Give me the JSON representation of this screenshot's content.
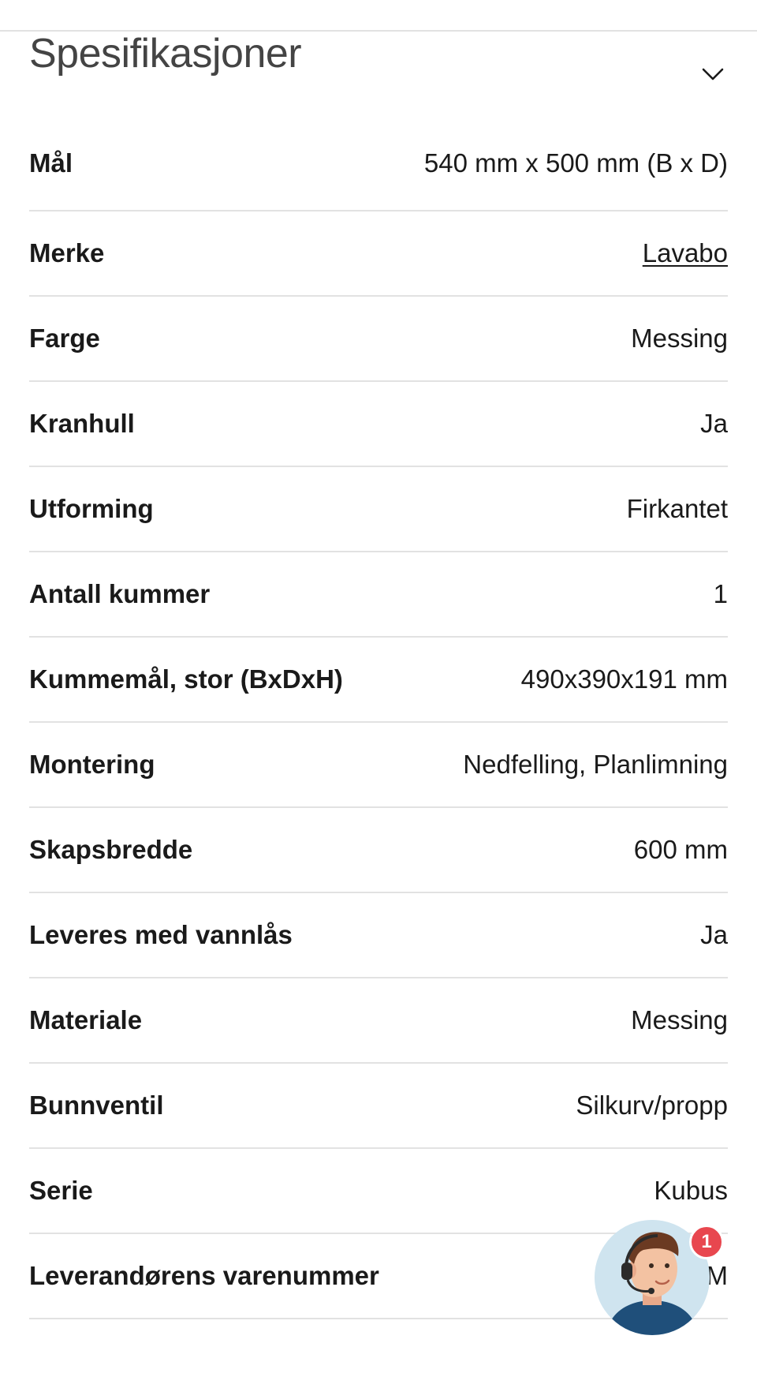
{
  "section": {
    "title": "Spesifikasjoner",
    "toggle_icon": "chevron-down-icon"
  },
  "specs": [
    {
      "label": "Mål",
      "value": "540 mm x 500 mm (B x D)"
    },
    {
      "label": "Merke",
      "value": "Lavabo"
    },
    {
      "label": "Farge",
      "value": "Messing"
    },
    {
      "label": "Kranhull",
      "value": "Ja"
    },
    {
      "label": "Utforming",
      "value": "Firkantet"
    },
    {
      "label": "Antall kummer",
      "value": "1"
    },
    {
      "label": "Kummemål, stor (BxDxH)",
      "value": "490x390x191 mm"
    },
    {
      "label": "Montering",
      "value": "Nedfelling, Planlimning"
    },
    {
      "label": "Skapsbredde",
      "value": "600 mm"
    },
    {
      "label": "Leveres med vannlås",
      "value": "Ja"
    },
    {
      "label": "Materiale",
      "value": "Messing"
    },
    {
      "label": "Bunnventil",
      "value": "Silkurv/propp"
    },
    {
      "label": "Serie",
      "value": "Kubus"
    },
    {
      "label": "Leverandørens varenummer",
      "value": "M"
    }
  ],
  "chat": {
    "avatar_icon": "support-agent-avatar-icon",
    "badge_count": "1"
  },
  "colors": {
    "divider": "#e2e2e2",
    "title": "#444444",
    "text": "#1a1a1a",
    "badge": "#e8474f"
  }
}
